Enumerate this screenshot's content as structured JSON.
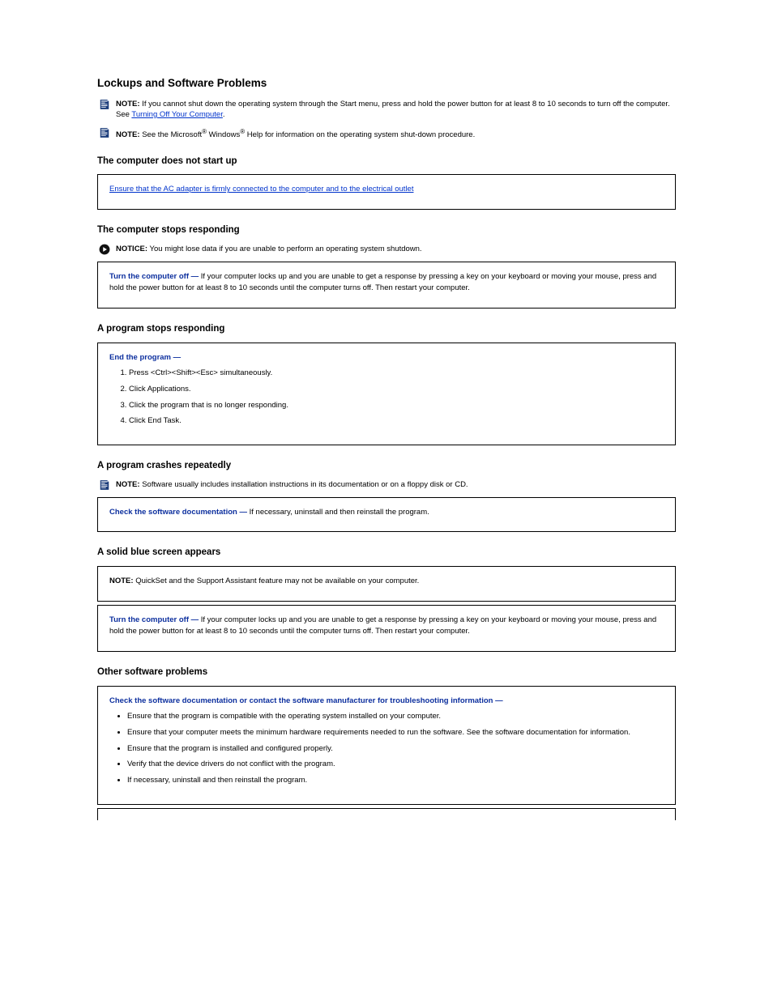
{
  "h_problems": "Lockups and Software Problems",
  "note1_b": "NOTE:",
  "note1_txt": " If you cannot shut down the operating system through the Start menu, press and hold the power button for at least 8 to 10 seconds to turn off the computer. See ",
  "note1_link": "Turning Off Your Computer",
  "note1_after": ".",
  "note2_b": "NOTE:",
  "note2_txt": " See the Microsoft",
  "note2_txt2": " Windows",
  "note2_txt3": " Help for information on the operating system shut-down procedure.",
  "h_no_start": "The computer does not start up",
  "box_no_start": "Ensure that the AC adapter is firmly connected to the computer and to the electrical outlet",
  "h_no_resp": "The computer stops responding",
  "notice_b": "NOTICE:",
  "notice_txt": " You might lose data if you are unable to perform an operating system shutdown.",
  "box_no_resp_lead": "Turn the computer off  —",
  "box_no_resp": "  If your computer locks up and you are unable to get a response by pressing a key on your keyboard or moving your mouse, press and hold the power button for at least 8 to 10 seconds until the computer turns off. Then restart your computer.",
  "h_prog_no_resp": "A program stops responding",
  "box_prog_lead": "End the program  —",
  "box_prog_steps": [
    "Press <Ctrl><Shift><Esc> simultaneously.",
    "Click Applications.",
    "Click the program that is no longer responding.",
    "Click End Task."
  ],
  "h_crash": "A program crashes repeatedly",
  "note3_b": "NOTE:",
  "note3_txt": " Software usually includes installation instructions in its documentation or on a floppy disk or CD.",
  "box_crash_lead": "Check the software documentation  —",
  "box_crash": " If necessary, uninstall and then reinstall the program.",
  "h_blue": "A solid blue screen appears",
  "note_assist_b": "NOTE:",
  "note_assist": " QuickSet and the Support Assistant feature may not be available on your computer.",
  "box_blue_lead": "Turn the computer off  —",
  "box_blue": "  If your computer locks up and you are unable to get a response by pressing a key on your keyboard or moving your mouse, press and hold the power button for at least 8 to 10 seconds until the computer turns off. Then restart your computer.",
  "h_other": "Other software problems",
  "box_other_lead": "Check the software documentation or contact the software manufacturer for troubleshooting information  —",
  "box_other": [
    "Ensure that the program is compatible with the operating system installed on your computer.",
    "Ensure that your computer meets the minimum hardware requirements needed to run the software. See the software documentation for information.",
    "Ensure that the program is installed and configured properly.",
    "Verify that the device drivers do not conflict with the program.",
    "If necessary, uninstall and then reinstall the program."
  ]
}
